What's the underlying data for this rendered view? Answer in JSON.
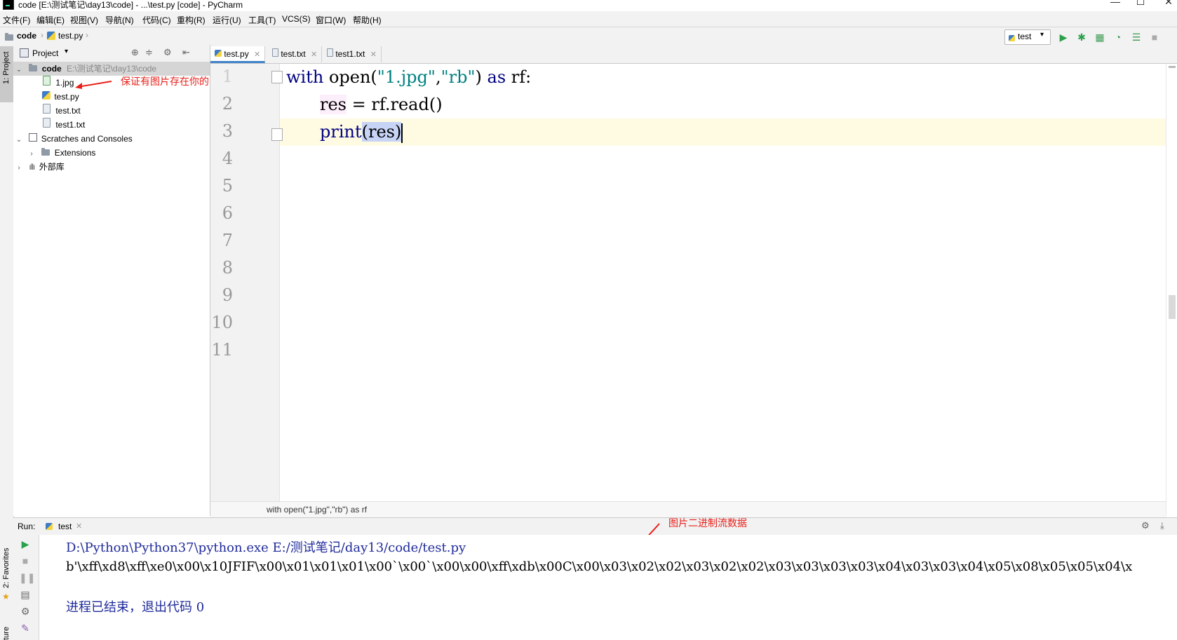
{
  "window": {
    "title": "code [E:\\测试笔记\\day13\\code] - ...\\test.py [code] - PyCharm",
    "minimize": "—",
    "maximize": "☐",
    "close": "✕"
  },
  "menu": [
    "文件(F)",
    "编辑(E)",
    "视图(V)",
    "导航(N)",
    "代码(C)",
    "重构(R)",
    "运行(U)",
    "工具(T)",
    "VCS(S)",
    "窗口(W)",
    "帮助(H)"
  ],
  "navbar": {
    "crumbs": [
      "code",
      "test.py"
    ],
    "run_config": "test"
  },
  "left_stripe": {
    "project_label": "1: Project",
    "favorites_label": "2: Favorites",
    "structure_label": "ture"
  },
  "project_panel": {
    "title": "Project",
    "tree": {
      "root_name": "code",
      "root_path": "E:\\测试笔记\\day13\\code",
      "files": [
        "1.jpg",
        "test.py",
        "test.txt",
        "test1.txt"
      ],
      "scratches": "Scratches and Consoles",
      "extensions": "Extensions",
      "external": "外部库"
    },
    "annotation": "保证有图片存在你的目录下"
  },
  "editor": {
    "tabs": [
      "test.py",
      "test.txt",
      "test1.txt"
    ],
    "line_numbers": [
      "1",
      "2",
      "3",
      "4",
      "5",
      "6",
      "7",
      "8",
      "9",
      "10",
      "11"
    ],
    "code": {
      "line1": {
        "kw_with": "with",
        "fn_open": " open(",
        "str_jpg": "\"1.jpg\"",
        "comma": ",",
        "str_rb": "\"rb\"",
        "close_paren": ") ",
        "kw_as": "as",
        "rest": " rf:"
      },
      "line2": {
        "var": "res",
        "rest": " = rf.read()"
      },
      "line3": {
        "fn": "print",
        "arg": "(res)"
      }
    },
    "breadcrumb": "with open(\"1.jpg\",\"rb\") as rf"
  },
  "run": {
    "label": "Run:",
    "tab": "test",
    "annotation": "图片二进制流数据",
    "console": {
      "command": "D:\\Python\\Python37\\python.exe E:/测试笔记/day13/code/test.py",
      "output": "b'\\xff\\xd8\\xff\\xe0\\x00\\x10JFIF\\x00\\x01\\x01\\x01\\x00`\\x00`\\x00\\x00\\xff\\xdb\\x00C\\x00\\x03\\x02\\x02\\x03\\x02\\x02\\x03\\x03\\x03\\x03\\x04\\x03\\x03\\x04\\x05\\x08\\x05\\x05\\x04\\x",
      "exit": "进程已结束，退出代码 0"
    }
  },
  "colors": {
    "accent": "#4083c9",
    "keyword": "#000080",
    "string": "#008080",
    "annotation": "#e8201a",
    "caret_line": "#fffbe3"
  }
}
